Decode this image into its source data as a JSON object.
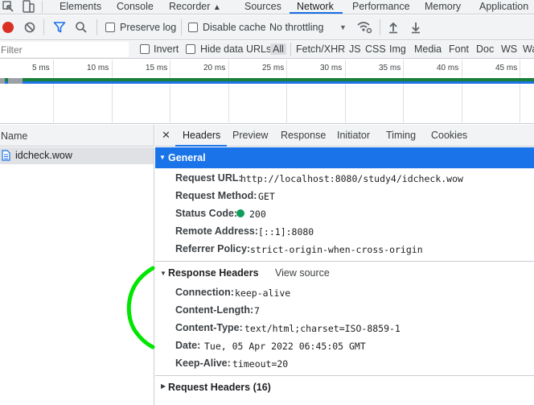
{
  "top_tabs": [
    {
      "label": "Elements"
    },
    {
      "label": "Console"
    },
    {
      "label": "Recorder"
    },
    {
      "label": "Sources"
    },
    {
      "label": "Network"
    },
    {
      "label": "Performance"
    },
    {
      "label": "Memory"
    },
    {
      "label": "Application"
    }
  ],
  "toolbar": {
    "preserve_log": "Preserve log",
    "disable_cache": "Disable cache",
    "throttling": "No throttling"
  },
  "filter": {
    "placeholder": "Filter",
    "invert": "Invert",
    "hide_data_urls": "Hide data URLs",
    "types": [
      "All",
      "Fetch/XHR",
      "JS",
      "CSS",
      "Img",
      "Media",
      "Font",
      "Doc",
      "WS",
      "Wa"
    ]
  },
  "timeline": {
    "ticks": [
      "5 ms",
      "10 ms",
      "15 ms",
      "20 ms",
      "25 ms",
      "30 ms",
      "35 ms",
      "40 ms",
      "45 ms"
    ]
  },
  "requests": {
    "column_header": "Name",
    "items": [
      {
        "name": "idcheck.wow"
      }
    ]
  },
  "detail_tabs": [
    "Headers",
    "Preview",
    "Response",
    "Initiator",
    "Timing",
    "Cookies"
  ],
  "general": {
    "title": "General",
    "rows": [
      {
        "key": "Request URL:",
        "value": "http://localhost:8080/study4/idcheck.wow"
      },
      {
        "key": "Request Method:",
        "value": "GET"
      },
      {
        "key": "Status Code:",
        "value": "200"
      },
      {
        "key": "Remote Address:",
        "value": "[::1]:8080"
      },
      {
        "key": "Referrer Policy:",
        "value": "strict-origin-when-cross-origin"
      }
    ]
  },
  "response_headers": {
    "title": "Response Headers",
    "view_source": "View source",
    "rows": [
      {
        "key": "Connection:",
        "value": "keep-alive"
      },
      {
        "key": "Content-Length:",
        "value": "7"
      },
      {
        "key": "Content-Type:",
        "value": "text/html;charset=ISO-8859-1"
      },
      {
        "key": "Date:",
        "value": "Tue, 05 Apr 2022 06:45:05 GMT"
      },
      {
        "key": "Keep-Alive:",
        "value": "timeout=20"
      }
    ]
  },
  "request_headers": {
    "title": "Request Headers (16)"
  },
  "colors": {
    "accent": "#1a73e8",
    "status_ok": "#0f9d58",
    "record": "#d93025",
    "annotation": "#00e600"
  },
  "icons": [
    "inspect-icon",
    "device-toggle-icon",
    "record-icon",
    "clear-icon",
    "filter-icon",
    "search-icon",
    "wifi-settings-icon",
    "import-icon",
    "export-icon",
    "file-icon",
    "close-icon",
    "triangle-down-icon",
    "triangle-right-icon",
    "status-dot-icon"
  ]
}
